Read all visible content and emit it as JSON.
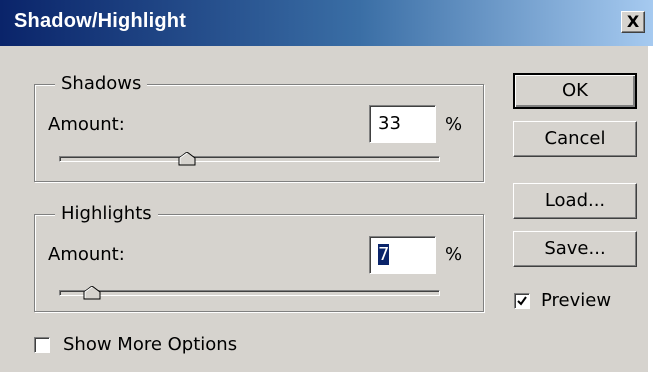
{
  "window": {
    "title": "Shadow/Highlight",
    "close_symbol": "X"
  },
  "shadows": {
    "legend": "Shadows",
    "amount_label": "Amount:",
    "amount_value": "33",
    "unit": "%",
    "slider_fraction": 0.33
  },
  "highlights": {
    "legend": "Highlights",
    "amount_label": "Amount:",
    "amount_value": "7",
    "unit": "%",
    "slider_fraction": 0.07
  },
  "buttons": {
    "ok": "OK",
    "cancel": "Cancel",
    "load": "Load...",
    "save": "Save..."
  },
  "options": {
    "preview_label": "Preview",
    "preview_checked": true,
    "show_more_label": "Show More Options",
    "show_more_checked": false
  },
  "colors": {
    "face": "#d6d3ce",
    "title_start": "#0a246a",
    "title_end": "#a6caf0",
    "selection": "#0a246a"
  },
  "icons": {
    "close": "close-icon",
    "slider_thumb": "slider-thumb-icon",
    "checkmark": "checkmark-icon"
  }
}
